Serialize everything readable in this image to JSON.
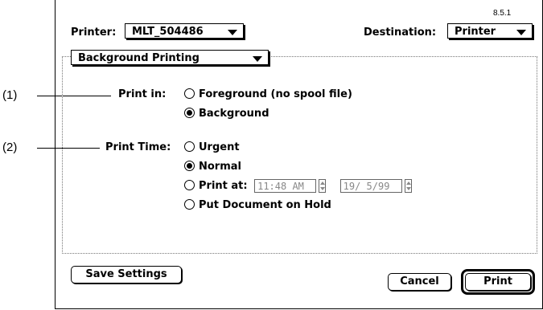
{
  "version": "8.5.1",
  "printer": {
    "label": "Printer:",
    "value": "MLT_504486"
  },
  "destination": {
    "label": "Destination:",
    "value": "Printer"
  },
  "section_popup": {
    "value": "Background Printing"
  },
  "print_in": {
    "label": "Print in:",
    "options": [
      {
        "label": "Foreground (no spool file)",
        "selected": false
      },
      {
        "label": "Background",
        "selected": true
      }
    ]
  },
  "print_time": {
    "label": "Print Time:",
    "options": [
      {
        "label": "Urgent",
        "selected": false
      },
      {
        "label": "Normal",
        "selected": true
      },
      {
        "label": "Print at:",
        "selected": false
      },
      {
        "label": "Put Document on Hold",
        "selected": false
      }
    ],
    "time_value": "11:48 AM",
    "date_value": "19/ 5/99"
  },
  "buttons": {
    "save": "Save Settings",
    "cancel": "Cancel",
    "print": "Print"
  },
  "callouts": {
    "one": "(1)",
    "two": "(2)"
  }
}
